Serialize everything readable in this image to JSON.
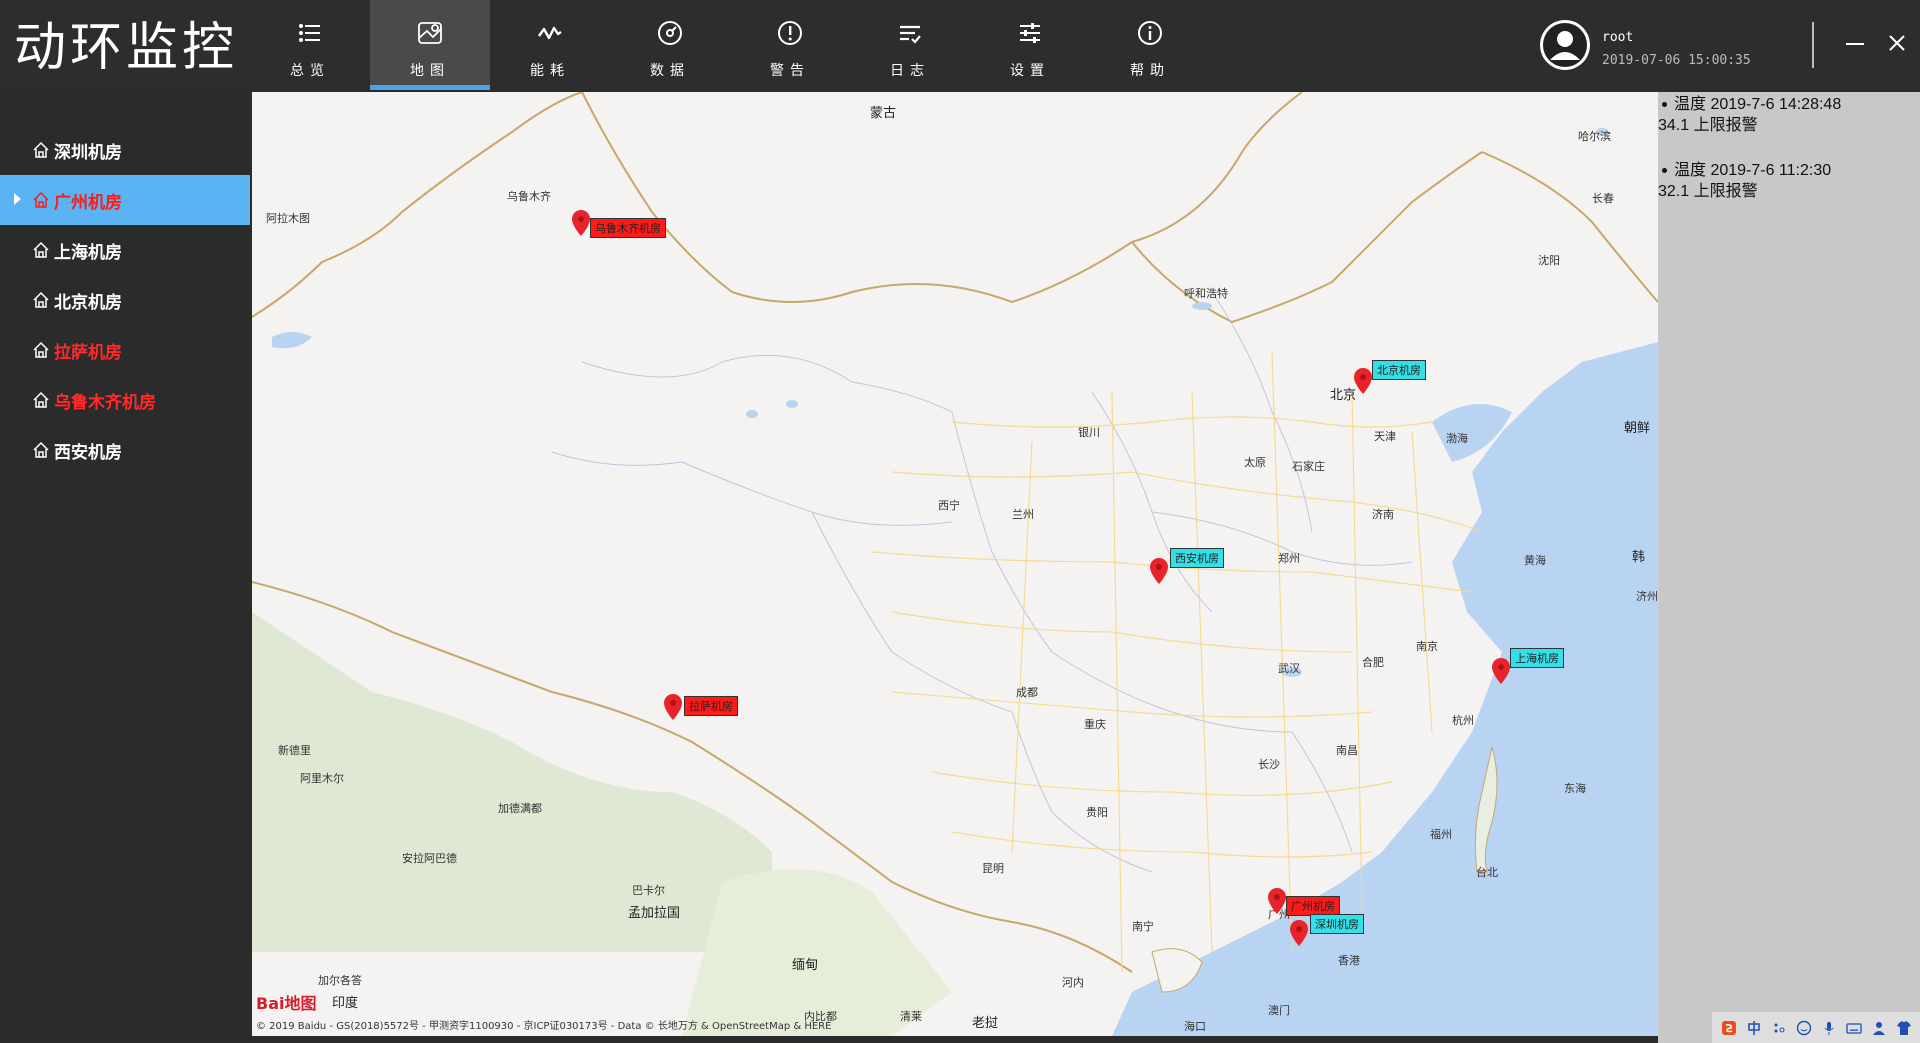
{
  "app": {
    "title": "动环监控"
  },
  "nav": {
    "items": [
      {
        "label": "总览",
        "icon": "list-icon"
      },
      {
        "label": "地图",
        "icon": "map-icon",
        "active": true
      },
      {
        "label": "能耗",
        "icon": "activity-icon"
      },
      {
        "label": "数据",
        "icon": "gauge-icon"
      },
      {
        "label": "警告",
        "icon": "alert-icon"
      },
      {
        "label": "日志",
        "icon": "log-icon"
      },
      {
        "label": "设置",
        "icon": "settings-icon"
      },
      {
        "label": "帮助",
        "icon": "info-icon"
      }
    ]
  },
  "user": {
    "name": "root",
    "time": "2019-07-06 15:00:35"
  },
  "window": {
    "minimize_icon": "minimize-icon",
    "close_icon": "close-icon"
  },
  "sidebar": {
    "items": [
      {
        "label": "深圳机房",
        "status": "normal"
      },
      {
        "label": "广州机房",
        "status": "alarm",
        "selected": true
      },
      {
        "label": "上海机房",
        "status": "normal"
      },
      {
        "label": "北京机房",
        "status": "normal"
      },
      {
        "label": "拉萨机房",
        "status": "alarm"
      },
      {
        "label": "乌鲁木齐机房",
        "status": "alarm"
      },
      {
        "label": "西安机房",
        "status": "normal"
      }
    ]
  },
  "map": {
    "markers": [
      {
        "label": "乌鲁木齐机房",
        "status": "alarm"
      },
      {
        "label": "北京机房",
        "status": "normal"
      },
      {
        "label": "西安机房",
        "status": "normal"
      },
      {
        "label": "上海机房",
        "status": "normal"
      },
      {
        "label": "拉萨机房",
        "status": "alarm"
      },
      {
        "label": "广州机房",
        "status": "alarm"
      },
      {
        "label": "深圳机房",
        "status": "normal"
      }
    ],
    "cities": {
      "mongolia": "蒙古",
      "urumqi": "乌鲁木齐",
      "aletai": "阿拉木图",
      "hohhot": "呼和浩特",
      "beijing": "北京",
      "tianjin": "天津",
      "taiyuan": "太原",
      "shijiazhuang": "石家庄",
      "yinchuan": "银川",
      "xining": "西宁",
      "lanzhou": "兰州",
      "jinan": "济南",
      "zhengzhou": "郑州",
      "xian": "西安",
      "nanjing": "南京",
      "hefei": "合肥",
      "shanghai": "上海",
      "hangzhou": "杭州",
      "wuhan": "武汉",
      "chengdu": "成都",
      "chongqing": "重庆",
      "changsha": "长沙",
      "nanchang": "南昌",
      "fuzhou": "福州",
      "taipei": "台北",
      "guiyang": "贵阳",
      "kunming": "昆明",
      "nanning": "南宁",
      "guangzhou": "广州",
      "xianggang": "香港",
      "aomen": "澳门",
      "haikou": "海口",
      "lhasa": "拉萨",
      "shenyang": "沈阳",
      "changchun": "长春",
      "harbin": "哈尔滨",
      "korea": "韩",
      "n_korea": "朝鲜",
      "bohai": "渤海",
      "huanghai": "黄海",
      "donghai": "东海",
      "newdelhi": "新德里",
      "india": "印度",
      "bangladesh": "孟加拉国",
      "myanmar": "缅甸",
      "laos": "老挝",
      "hanoi": "河内",
      "kathmandu": "加德满都",
      "dhaka": "巴卡尔",
      "islamabad": "阿里木尔",
      "delhi2": "安拉阿巴德",
      "qingdao": "清莱",
      "jeju": "济州",
      "naypyidaw": "内比都",
      "kolkata": "加尔各答"
    },
    "logo_text": "Bai地图",
    "attribution": "© 2019 Baidu - GS(2018)5572号 - 甲测资字1100930 - 京ICP证030173号 - Data © 长地万方 & OpenStreetMap & HERE"
  },
  "alarms": [
    {
      "title": "温度 2019-7-6 14:28:48",
      "detail": "34.1 上限报警"
    },
    {
      "title": "温度 2019-7-6 11:2:30",
      "detail": "32.1 上限报警"
    }
  ],
  "tray": {
    "icons": [
      "sogou-icon",
      "chinese-ime-icon",
      "punctuation-icon",
      "emoji-icon",
      "mic-icon",
      "keyboard-icon",
      "user-icon",
      "shirt-icon",
      "grid-icon"
    ]
  },
  "colors": {
    "topbar": "#2d2d2d",
    "accent": "#4aa3e8",
    "selected_item": "#5ab3f2",
    "alarm_red": "#ff2b2b",
    "marker_red": "#ff1a1a",
    "marker_cyan": "#33e0e8"
  }
}
